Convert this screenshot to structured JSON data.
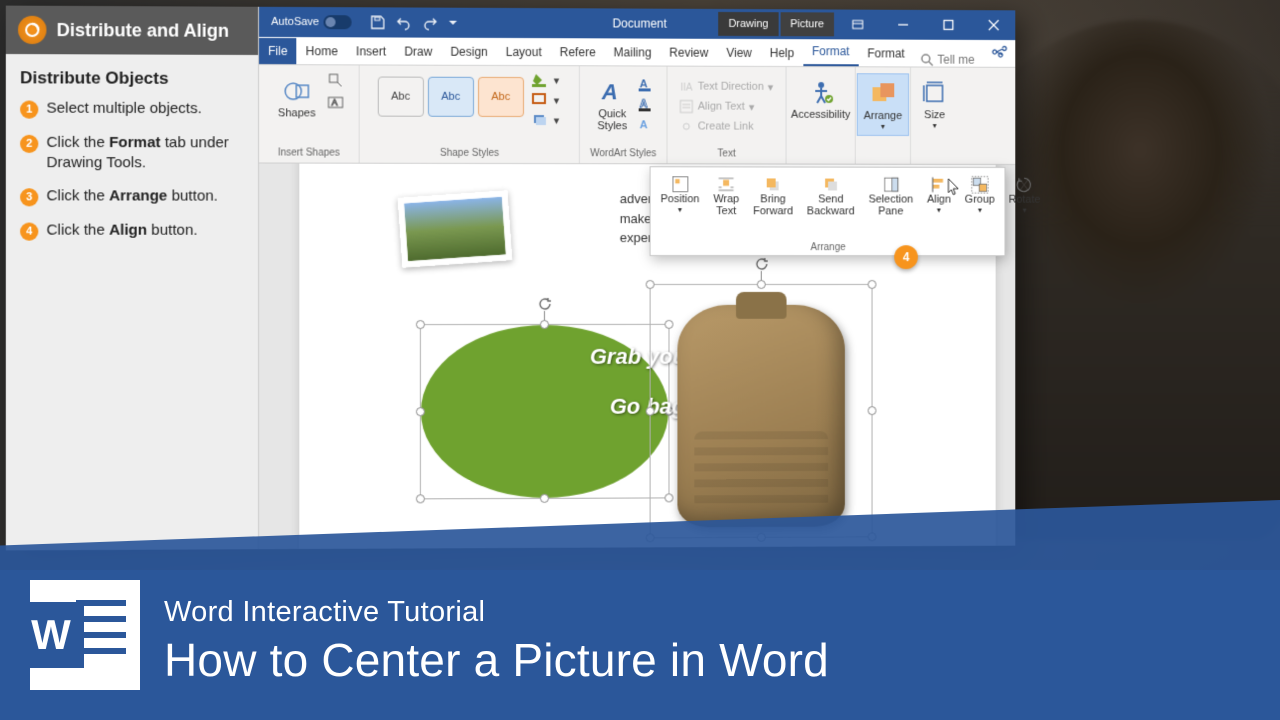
{
  "sidebar": {
    "header": "Distribute and Align",
    "title": "Distribute Objects",
    "steps": [
      {
        "n": "1",
        "html": "Select multiple objects."
      },
      {
        "n": "2",
        "html": "Click the Format tab under Drawing Tools."
      },
      {
        "n": "3",
        "html": "Click the Arrange button."
      },
      {
        "n": "4",
        "html": "Click the Align button."
      }
    ]
  },
  "titlebar": {
    "autosave": "AutoSave",
    "doc_title": "Document",
    "context_tabs": [
      "Drawing",
      "Picture"
    ]
  },
  "tabs": {
    "file": "File",
    "list": [
      "Home",
      "Insert",
      "Draw",
      "Design",
      "Layout",
      "Refere",
      "Mailing",
      "Review",
      "View",
      "Help"
    ],
    "format1": "Format",
    "format2": "Format",
    "tellme": "Tell me"
  },
  "ribbon": {
    "insert_shapes": {
      "shapes": "Shapes",
      "label": "Insert Shapes"
    },
    "shape_styles": {
      "abc": "Abc",
      "label": "Shape Styles"
    },
    "wordart": {
      "quick_styles": "Quick\nStyles",
      "label": "WordArt Styles"
    },
    "text": {
      "text_direction": "Text Direction",
      "align_text": "Align Text",
      "create_link": "Create Link",
      "label": "Text"
    },
    "accessibility": {
      "btn": "Accessibility",
      "label": ""
    },
    "arrange": {
      "btn": "Arrange",
      "label": ""
    },
    "size": {
      "btn": "Size",
      "label": ""
    }
  },
  "arrange_panel": {
    "position": "Position",
    "wrap_text": "Wrap\nText",
    "bring_forward": "Bring\nForward",
    "send_backward": "Send\nBackward",
    "selection_pane": "Selection\nPane",
    "align": "Align",
    "group": "Group",
    "rotate": "Rotate",
    "label": "Arrange",
    "badge": "4"
  },
  "doc": {
    "body_frag1": "advent",
    "body_frag2": "make y",
    "body_frag3": "experie",
    "grab1": "Grab your",
    "grab2": "Go bag!"
  },
  "banner": {
    "subtitle": "Word Interactive Tutorial",
    "title": "How to Center a Picture in Word"
  }
}
